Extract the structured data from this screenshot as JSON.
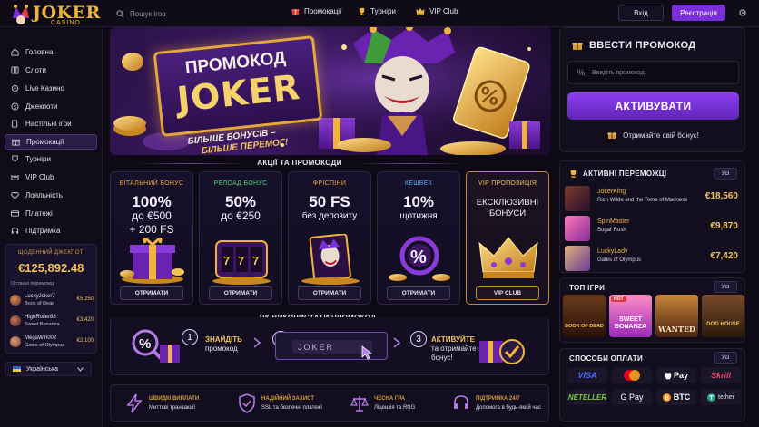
{
  "header": {
    "logo_main": "JOKER",
    "logo_sub": "CASINO",
    "search_placeholder": "Пошук ігор",
    "nav": [
      {
        "label": "Промокації",
        "icon": "gift-icon"
      },
      {
        "label": "Турніри",
        "icon": "trophy-icon"
      },
      {
        "label": "VIP Club",
        "icon": "crown-icon"
      }
    ],
    "login": "Вхід",
    "register": "Реєстрація"
  },
  "sidebar": {
    "items": [
      {
        "label": "Головна",
        "icon": "home-icon",
        "active": false
      },
      {
        "label": "Слоти",
        "icon": "slots-icon",
        "active": false
      },
      {
        "label": "Live Казино",
        "icon": "live-icon",
        "active": false
      },
      {
        "label": "Джекпоти",
        "icon": "jackpot-icon",
        "active": false
      },
      {
        "label": "Настільні ігри",
        "icon": "table-games-icon",
        "active": false
      },
      {
        "label": "Промокації",
        "icon": "gift-icon",
        "active": true
      },
      {
        "label": "Турніри",
        "icon": "trophy-icon",
        "active": false
      },
      {
        "label": "VIP Club",
        "icon": "crown-icon",
        "active": false
      },
      {
        "label": "Лояльність",
        "icon": "loyalty-icon",
        "active": false
      },
      {
        "label": "Платежі",
        "icon": "card-icon",
        "active": false
      },
      {
        "label": "Підтримка",
        "icon": "support-icon",
        "active": false
      }
    ],
    "jackpot": {
      "title": "ЩОДЕННИЙ ДЖЕКПОТ",
      "amount": "€125,892.48",
      "recent_label": "Останні переможці",
      "winners": [
        {
          "name": "LuckyJoker7",
          "game": "Book of Dead",
          "amount": "€5,250"
        },
        {
          "name": "HighRoller88",
          "game": "Sweet Bonanza",
          "amount": "€3,420"
        },
        {
          "name": "MegaWin002",
          "game": "Gates of Olympus",
          "amount": "€2,100"
        }
      ]
    },
    "language": "Українська"
  },
  "hero": {
    "line1": "ПРОМОКОД",
    "line2": "JOKER",
    "sub1": "БІЛЬШЕ БОНУСІВ –",
    "sub2": "БІЛЬШЕ ПЕРЕМОГ!"
  },
  "promo_panel": {
    "title": "ВВЕСТИ ПРОМОКОД",
    "placeholder": "Введіть промокод",
    "activate": "АКТИВУВАТИ",
    "get_bonus": "Отримайте свій бонус!"
  },
  "offers": {
    "title": "АКЦІЇ ТА ПРОМОКОДИ",
    "cards": [
      {
        "category": "ВІТАЛЬНИЙ БОНУС",
        "cat_color": "#f2a93b",
        "big": "100%",
        "l2": "до €500",
        "l3": "+ 200 FS",
        "button": "ОТРИМАТИ"
      },
      {
        "category": "РЕЛОАД БОНУС",
        "cat_color": "#4fd37a",
        "big": "50%",
        "l2": "до €250",
        "l3": "",
        "button": "ОТРИМАТИ"
      },
      {
        "category": "ФРІСПІНИ",
        "cat_color": "#f2a93b",
        "big": "50 FS",
        "l2": "без депозиту",
        "l3": "",
        "button": "ОТРИМАТИ"
      },
      {
        "category": "КЕШБЕК",
        "cat_color": "#4fb4ff",
        "big": "10%",
        "l2": "щотижня",
        "l3": "",
        "button": "ОТРИМАТИ"
      },
      {
        "category": "VIP ПРОПОЗИЦІЯ",
        "cat_color": "#f2c35a",
        "big": "",
        "l2": "ЕКСКЛЮЗИВНІ",
        "l3": "БОНУСИ",
        "button": "VIP CLUB"
      }
    ]
  },
  "howto": {
    "title": "ЯК ВИКОРИСТАТИ ПРОМОКОД",
    "steps": [
      {
        "num": "1",
        "bold": "ЗНАЙДІТЬ",
        "rest": "промокод"
      },
      {
        "num": "2",
        "code": "JOKER"
      },
      {
        "num": "3",
        "bold": "АКТИВУЙТЕ",
        "rest": "та отримайте бонус!"
      }
    ]
  },
  "features": [
    {
      "title": "ШВИДКІ ВИПЛАТИ",
      "sub": "Миттєві транзакції",
      "icon": "lightning-icon"
    },
    {
      "title": "НАДІЙНИЙ ЗАХИСТ",
      "sub": "SSL та безпечні платежі",
      "icon": "shield-icon"
    },
    {
      "title": "ЧЕСНА ГРА",
      "sub": "Ліцензія та RNG",
      "icon": "scales-icon"
    },
    {
      "title": "ПІДТРИМКА 24/7",
      "sub": "Допомога в будь-який час",
      "icon": "headset-icon"
    }
  ],
  "winners_panel": {
    "title": "АКТИВНІ ПЕРЕМОЖЦІ",
    "all": "Усі",
    "rows": [
      {
        "name": "JokerKing",
        "game": "Rich Wilde and the Tome of Madness",
        "amount": "€18,560"
      },
      {
        "name": "SpinMaster",
        "game": "Sugar Rush",
        "amount": "€9,870"
      },
      {
        "name": "LuckyLady",
        "game": "Gates of Olympus",
        "amount": "€7,420"
      }
    ]
  },
  "top_games": {
    "title": "ТОП ІГРИ",
    "all": "Усі",
    "games": [
      {
        "label": "BOOK OF DEAD"
      },
      {
        "label": "SWEET BONANZA",
        "badge": "HOT"
      },
      {
        "label": "WANTED"
      },
      {
        "label": "DOG HOUSE"
      }
    ]
  },
  "payments": {
    "title": "СПОСОБИ ОПЛАТИ",
    "all": "Усі",
    "methods": [
      "VISA",
      "mastercard",
      "Pay",
      "Skrill",
      "NETELLER",
      "G Pay",
      "BTC",
      "tether"
    ]
  }
}
